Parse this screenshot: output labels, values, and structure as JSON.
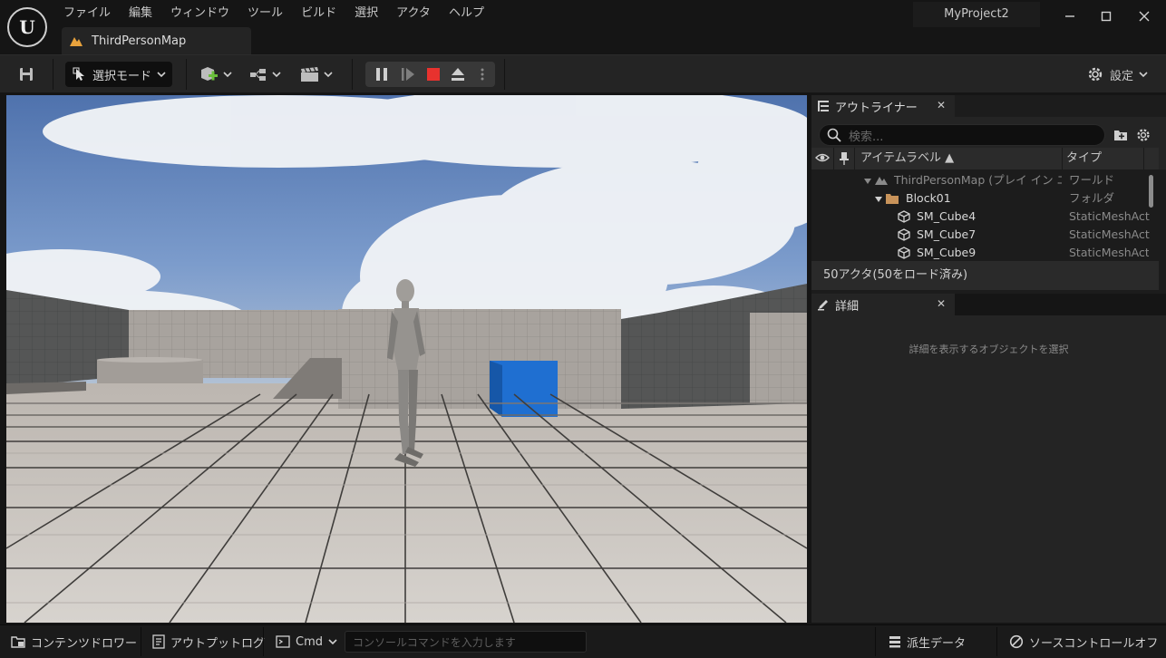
{
  "menu": [
    "ファイル",
    "編集",
    "ウィンドウ",
    "ツール",
    "ビルド",
    "選択",
    "アクタ",
    "ヘルプ"
  ],
  "project_name": "MyProject2",
  "logo_text": "U",
  "tab": {
    "label": "ThirdPersonMap",
    "icon": "map-icon"
  },
  "toolbar": {
    "mode_label": "選択モード",
    "settings_label": "設定",
    "icons": [
      "save-icon",
      "select-mode-icon",
      "add-actor-icon",
      "blueprint-icon",
      "cinematics-icon",
      "pause-icon",
      "step-icon",
      "stop-icon",
      "eject-icon",
      "more-icon",
      "gear-icon"
    ],
    "stop_color": "#e8322e"
  },
  "outliner": {
    "tab_label": "アウトライナー",
    "search_placeholder": "検索...",
    "col_label": "アイテムラベル ▲",
    "col_type": "タイプ",
    "rows": [
      {
        "label": "ThirdPersonMap (プレイ イン エデ",
        "type": "ワールド",
        "icon": "world-icon"
      },
      {
        "label": "Block01",
        "type": "フォルダ",
        "icon": "folder-icon"
      },
      {
        "label": "SM_Cube4",
        "type": "StaticMeshAct",
        "icon": "static-mesh-icon"
      },
      {
        "label": "SM_Cube7",
        "type": "StaticMeshAct",
        "icon": "static-mesh-icon"
      },
      {
        "label": "SM_Cube9",
        "type": "StaticMeshAct",
        "icon": "static-mesh-icon"
      }
    ],
    "status": "50アクタ(50をロード済み)"
  },
  "details": {
    "tab_label": "詳細",
    "empty_text": "詳細を表示するオブジェクトを選択"
  },
  "statusbar": {
    "content_drawer": "コンテンツドロワー",
    "output_log": "アウトプットログ",
    "cmd_label": "Cmd",
    "console_placeholder": "コンソールコマンドを入力します",
    "derived_data": "派生データ",
    "source_control": "ソースコントロールオフ"
  },
  "colors": {
    "accent_blue": "#1f6fd1",
    "folder": "#c8935a",
    "map_icon": "#e8a23c"
  }
}
